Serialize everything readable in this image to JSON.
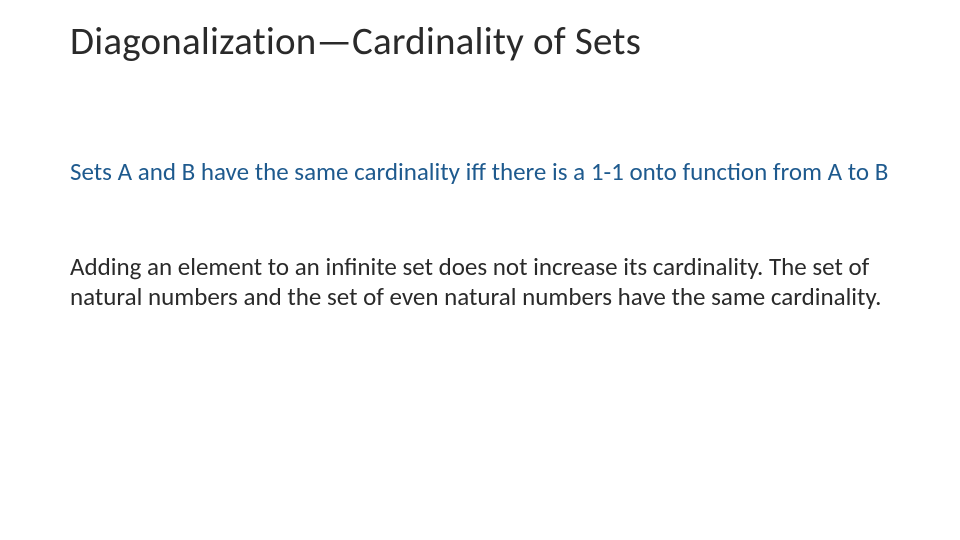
{
  "title": "Diagonalization—Cardinality of Sets",
  "definition": "Sets A and B have the same cardinality iff there is a 1-1 onto function from A to B",
  "body": "Adding an element to an  infinite set does not increase its cardinality. The set of natural numbers and the set of even natural numbers have the same cardinality."
}
